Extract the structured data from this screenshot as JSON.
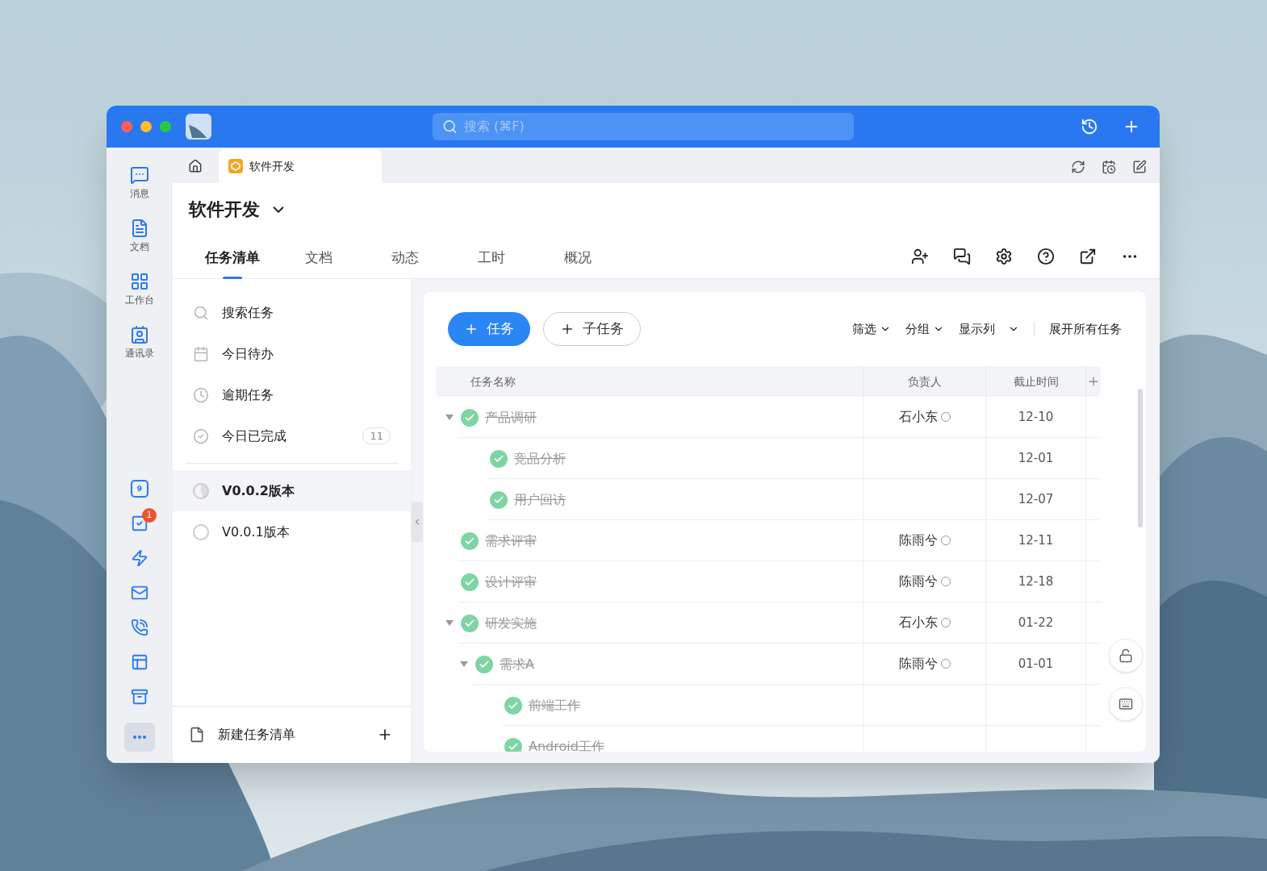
{
  "search": {
    "placeholder": "搜索 (⌘F)"
  },
  "rail": {
    "top": [
      {
        "kind": "message",
        "label": "消息"
      },
      {
        "kind": "doc",
        "label": "文档"
      },
      {
        "kind": "apps",
        "label": "工作台"
      },
      {
        "kind": "contacts",
        "label": "通讯录"
      }
    ],
    "bottom": [
      {
        "kind": "calendar",
        "text": "9"
      },
      {
        "kind": "todo",
        "badge": "1"
      },
      {
        "kind": "bolt"
      },
      {
        "kind": "mail"
      },
      {
        "kind": "phone"
      },
      {
        "kind": "board"
      },
      {
        "kind": "archive"
      },
      {
        "kind": "more",
        "selected": true
      }
    ]
  },
  "open_tabs": [
    {
      "label": "软件开发",
      "selected": true
    }
  ],
  "project": {
    "title": "软件开发"
  },
  "nav_tabs": [
    {
      "label": "任务清单",
      "selected": true
    },
    {
      "label": "文档",
      "selected": false
    },
    {
      "label": "动态",
      "selected": false
    },
    {
      "label": "工时",
      "selected": false
    },
    {
      "label": "概况",
      "selected": false
    }
  ],
  "side": {
    "filters": [
      {
        "kind": "search",
        "label": "搜索任务"
      },
      {
        "kind": "today",
        "label": "今日待办"
      },
      {
        "kind": "overdue",
        "label": "逾期任务"
      },
      {
        "kind": "done",
        "label": "今日已完成",
        "count": "11"
      }
    ],
    "lists": [
      {
        "label": "V0.0.2版本",
        "selected": true
      },
      {
        "label": "V0.0.1版本",
        "selected": false
      }
    ],
    "new_list": "新建任务清单"
  },
  "toolbar": {
    "add_task": "任务",
    "add_subtask": "子任务",
    "menus": [
      "筛选",
      "分组",
      "显示列"
    ],
    "expand_all": "展开所有任务"
  },
  "table": {
    "columns": [
      "任务名称",
      "负责人",
      "截止时间"
    ],
    "tasks": [
      {
        "name": "产品调研",
        "assignee": "石小东",
        "due": "12-10",
        "done": true,
        "expanded": true,
        "children": [
          {
            "name": "竞品分析",
            "due": "12-01",
            "done": true
          },
          {
            "name": "用户回访",
            "due": "12-07",
            "done": true
          }
        ]
      },
      {
        "name": "需求评审",
        "assignee": "陈雨兮",
        "due": "12-11",
        "done": true
      },
      {
        "name": "设计评审",
        "assignee": "陈雨兮",
        "due": "12-18",
        "done": true
      },
      {
        "name": "研发实施",
        "assignee": "石小东",
        "due": "01-22",
        "done": true,
        "expanded": true,
        "children": [
          {
            "name": "需求A",
            "assignee": "陈雨兮",
            "due": "01-01",
            "done": true,
            "expanded": true,
            "children": [
              {
                "name": "前端工作",
                "done": true
              },
              {
                "name": "Android工作",
                "done": true
              }
            ]
          }
        ]
      }
    ]
  }
}
